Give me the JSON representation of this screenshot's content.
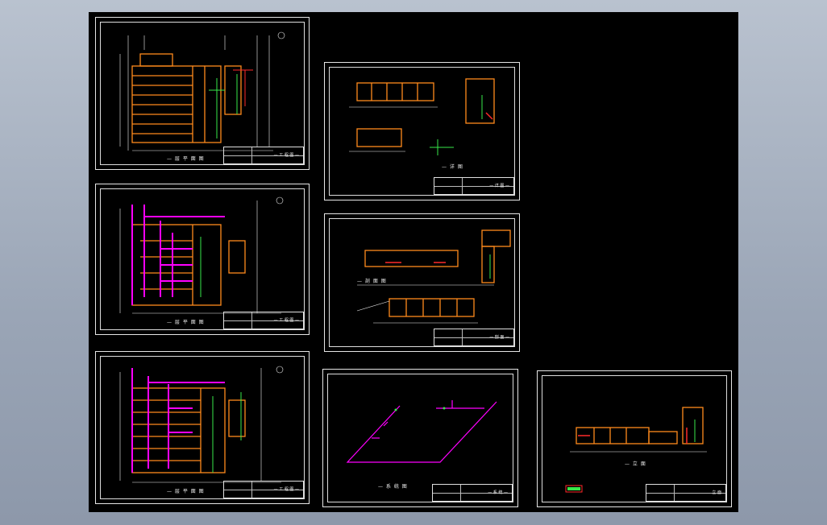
{
  "viewer": {
    "background": "#000000",
    "frame_color": "#e6e6e6"
  },
  "palette": {
    "wall": "#ff8a1c",
    "pipe": "#ff00ff",
    "green": "#37e84a",
    "cyan": "#33e0ff",
    "red": "#ff2a2a",
    "white": "#f0f0f0"
  },
  "sheets": [
    {
      "caption": "— 层 平 面 图",
      "title_block": "— 工 程 图 —"
    },
    {
      "caption": "— 层 平 面 图",
      "title_block": "— 工 程 图 —"
    },
    {
      "caption": "— 层 平 面 图",
      "title_block": "— 工 程 图 —"
    },
    {
      "caption": "— 详 图",
      "title_block": "— 详 图 —"
    },
    {
      "caption": "— 剖 面 图",
      "title_block": "— 剖 面 —"
    },
    {
      "caption": "— 系 统 图",
      "title_block": "— 系 统 —"
    },
    {
      "caption": "— 立 面",
      "title_block": "立 面"
    }
  ]
}
